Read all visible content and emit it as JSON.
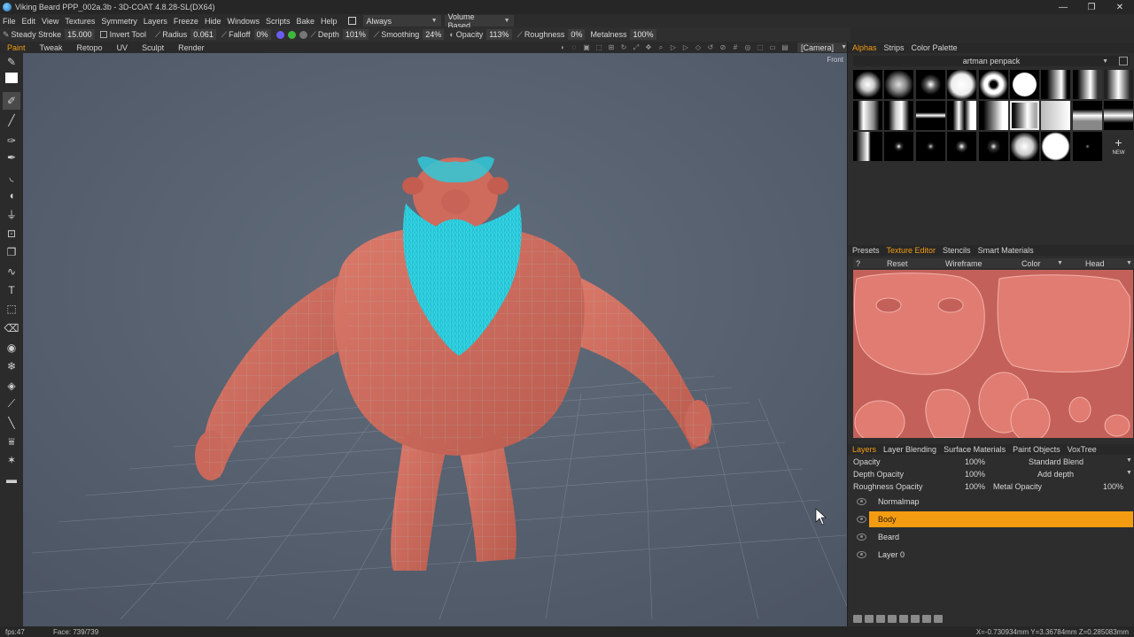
{
  "window": {
    "title": "Viking Beard PPP_002a.3b - 3D-COAT 4.8.28-SL(DX64)",
    "minimize_glyph": "—",
    "maximize_glyph": "❐",
    "close_glyph": "✕"
  },
  "menu": {
    "items": [
      "File",
      "Edit",
      "View",
      "Textures",
      "Symmetry",
      "Layers",
      "Freeze",
      "Hide",
      "Windows",
      "Scripts",
      "Bake",
      "Help"
    ],
    "always_label": "Always",
    "volume_label": "Volume Based"
  },
  "tool_options": {
    "steady_label": "Steady Stroke",
    "steady_value": "15.000",
    "invert_label": "Invert Tool",
    "radius_label": "Radius",
    "radius_value": "0.061",
    "falloff_label": "Falloff",
    "falloff_value": "0%",
    "depth_label": "Depth",
    "depth_value": "101%",
    "smoothing_label": "Smoothing",
    "smoothing_value": "24%",
    "opacity_label": "Opacity",
    "opacity_value": "113%",
    "roughness_label": "Roughness",
    "roughness_value": "0%",
    "metalness_label": "Metalness",
    "metalness_value": "100%"
  },
  "rooms": {
    "tabs": [
      "Paint",
      "Tweak",
      "Retopo",
      "UV",
      "Sculpt",
      "Render"
    ],
    "active": "Paint",
    "camera_label": "[Camera]"
  },
  "viewport": {
    "view_label": "Front"
  },
  "status": {
    "fps": "fps:47",
    "face": "Face: 739/739",
    "coords": "X=-0.730934mm Y=3.36784mm Z=0.285083mm"
  },
  "alphas_panel": {
    "tabs": [
      "Alphas",
      "Strips",
      "Color Palette"
    ],
    "active_tab": "Alphas",
    "preset": "artman penpack",
    "new_label": "NEW"
  },
  "texture_panel": {
    "tabs": [
      "Presets",
      "Texture Editor",
      "Stencils",
      "Smart Materials"
    ],
    "active_tab": "Texture Editor",
    "help": "?",
    "reset": "Reset",
    "wireframe": "Wireframe",
    "channel": "Color",
    "object": "Head"
  },
  "layers_panel": {
    "tabs": [
      "Layers",
      "Layer Blending",
      "Surface Materials",
      "Paint Objects",
      "VoxTree"
    ],
    "active_tab": "Layers",
    "opacity_label": "Opacity",
    "opacity_value": "100%",
    "blend_mode": "Standard Blend",
    "depth_opacity_label": "Depth Opacity",
    "depth_opacity_value": "100%",
    "depth_mode": "Add depth",
    "roughness_opacity_label": "Roughness Opacity",
    "roughness_opacity_value": "100%",
    "metal_opacity_label": "Metal Opacity",
    "metal_opacity_value": "100%",
    "layers": [
      "Normalmap",
      "Body",
      "Beard",
      "Layer 0"
    ],
    "active_layer": "Body"
  },
  "colors": {
    "accent": "#f39c12",
    "viewport_bg": "#56606f",
    "skin": "#cf6b5c",
    "beard": "#33d6e6"
  }
}
